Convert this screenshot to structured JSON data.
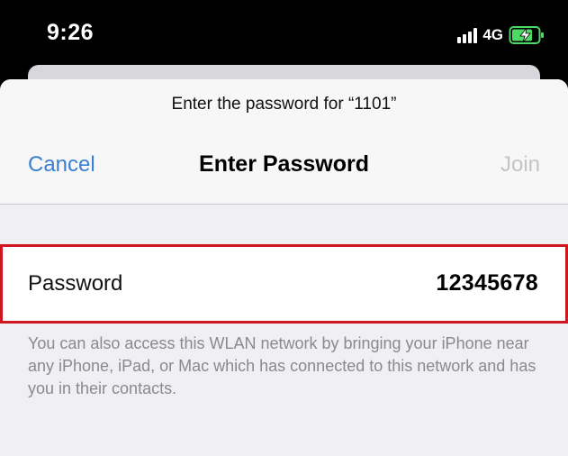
{
  "status_bar": {
    "time": "9:26",
    "network": "4G",
    "battery_icon": "battery-charging-icon",
    "signal_icon": "cellular-signal-icon",
    "battery_color": "#4cd964"
  },
  "sheet": {
    "prompt": "Enter the password for “1101”",
    "title": "Enter Password",
    "cancel_label": "Cancel",
    "join_label": "Join"
  },
  "password_field": {
    "label": "Password",
    "value": "12345678",
    "highlight_color": "#d0161e"
  },
  "footnote": "You can also access this WLAN network by bringing your iPhone near any iPhone, iPad, or Mac which has connected to this network and has you in their contacts.",
  "colors": {
    "accent": "#3a7fd0",
    "disabled": "#c4c4c8"
  }
}
